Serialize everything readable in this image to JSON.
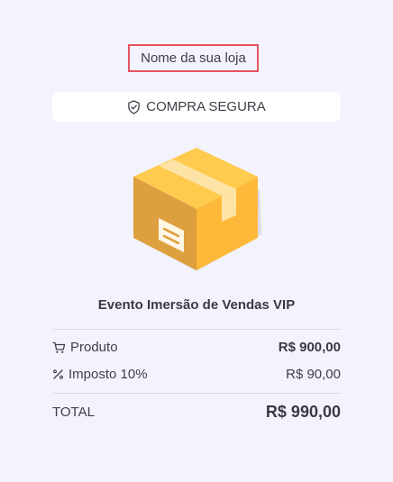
{
  "header": {
    "store_name": "Nome da sua loja"
  },
  "secure_badge": {
    "icon": "shield-check-icon",
    "label": "COMPRA SEGURA"
  },
  "product": {
    "image_icon": "package-box-icon",
    "title": "Evento Imersão de Vendas VIP"
  },
  "summary": {
    "product_row": {
      "icon": "cart-icon",
      "label": "Produto",
      "value": "R$ 900,00"
    },
    "tax_row": {
      "icon": "percent-icon",
      "label": "Imposto 10%",
      "value": "R$ 90,00"
    },
    "total_row": {
      "label": "TOTAL",
      "value": "R$ 990,00"
    }
  },
  "colors": {
    "background": "#f3f3fd",
    "highlight_border": "#e5535f",
    "box_front": "#ffb838",
    "box_side": "#dc9e3c",
    "box_top": "#ffca4f"
  }
}
